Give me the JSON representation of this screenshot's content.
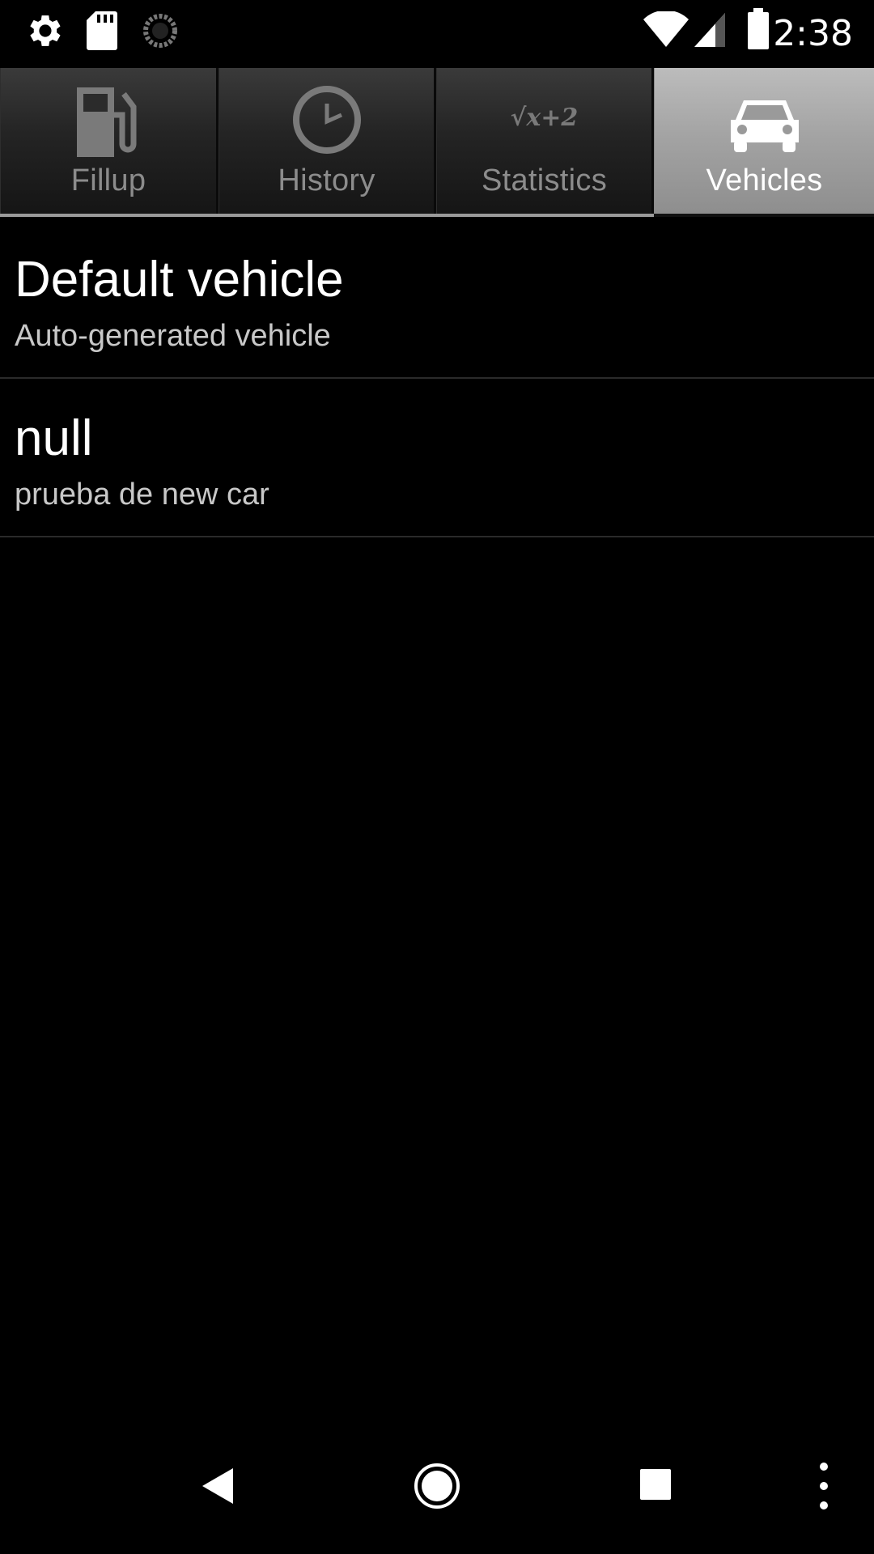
{
  "status_bar": {
    "time": "2:38",
    "left_icons": [
      "gear-icon",
      "sd-card-icon",
      "sync-icon"
    ],
    "right_icons": [
      "wifi-icon",
      "cell-signal-icon",
      "battery-icon"
    ]
  },
  "tabs": [
    {
      "label": "Fillup",
      "icon": "fuel-pump-icon",
      "selected": false
    },
    {
      "label": "History",
      "icon": "clock-icon",
      "selected": false
    },
    {
      "label": "Statistics",
      "icon": "formula-icon",
      "icon_text": "√x+2",
      "selected": false
    },
    {
      "label": "Vehicles",
      "icon": "car-icon",
      "selected": true
    }
  ],
  "vehicles": [
    {
      "title": "Default vehicle",
      "subtitle": "Auto-generated vehicle"
    },
    {
      "title": "null",
      "subtitle": "prueba de new car"
    }
  ],
  "nav_bar": {
    "buttons": [
      "back-icon",
      "home-icon",
      "recents-icon",
      "more-options-icon"
    ]
  },
  "colors": {
    "background": "#000000",
    "tab_selected": "#a4a4a4",
    "tab_unselected": "#242424",
    "text_primary": "#ffffff",
    "text_secondary": "#c8c8c8"
  }
}
